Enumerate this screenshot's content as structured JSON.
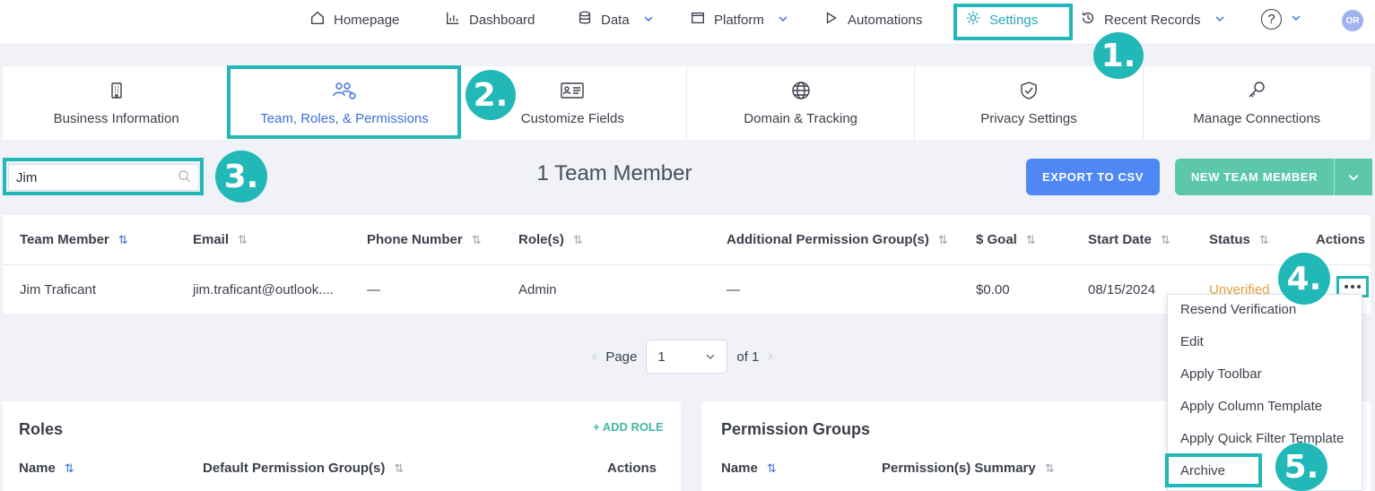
{
  "nav": {
    "items": [
      {
        "label": "Homepage",
        "icon": "home-icon"
      },
      {
        "label": "Dashboard",
        "icon": "dashboard-icon"
      },
      {
        "label": "Data",
        "icon": "database-icon"
      },
      {
        "label": "Platform",
        "icon": "window-icon"
      },
      {
        "label": "Automations",
        "icon": "play-icon"
      },
      {
        "label": "Settings",
        "icon": "gear-icon"
      },
      {
        "label": "Recent Records",
        "icon": "history-icon"
      }
    ],
    "help": "?",
    "avatar": "OR"
  },
  "tabs": [
    {
      "label": "Business Information",
      "icon": "building-icon"
    },
    {
      "label": "Team, Roles, & Permissions",
      "icon": "team-icon"
    },
    {
      "label": "Customize Fields",
      "icon": "id-card-icon"
    },
    {
      "label": "Domain & Tracking",
      "icon": "globe-icon"
    },
    {
      "label": "Privacy Settings",
      "icon": "shield-check-icon"
    },
    {
      "label": "Manage Connections",
      "icon": "key-icon"
    }
  ],
  "toolbar": {
    "search_value": "Jim",
    "member_count": "1 Team Member",
    "export_label": "EXPORT TO CSV",
    "new_label": "NEW TEAM MEMBER"
  },
  "table": {
    "columns": [
      "Team Member",
      "Email",
      "Phone Number",
      "Role(s)",
      "Additional Permission Group(s)",
      "$ Goal",
      "Start Date",
      "Status",
      "Actions"
    ],
    "rows": [
      {
        "name": "Jim Traficant",
        "email": "jim.traficant@outlook....",
        "phone": "—",
        "role": "Admin",
        "groups": "—",
        "goal": "$0.00",
        "start": "08/15/2024",
        "status": "Unverified"
      }
    ]
  },
  "pager": {
    "label": "Page",
    "page": "1",
    "of": "of 1"
  },
  "roles": {
    "title": "Roles",
    "add": "+ ADD ROLE",
    "columns": [
      "Name",
      "Default Permission Group(s)",
      "Actions"
    ]
  },
  "permissions": {
    "title": "Permission Groups",
    "columns": [
      "Name",
      "Permission(s) Summary"
    ]
  },
  "menu": {
    "items": [
      "Resend Verification",
      "Edit",
      "Apply Toolbar",
      "Apply Column Template",
      "Apply Quick Filter Template",
      "Archive"
    ]
  },
  "annotations": [
    "1.",
    "2.",
    "3.",
    "4.",
    "5."
  ],
  "colors": {
    "accent": "#22b8b8",
    "primary": "#4f87f5",
    "success": "#5cc8a9",
    "warning": "#e6a03c"
  }
}
